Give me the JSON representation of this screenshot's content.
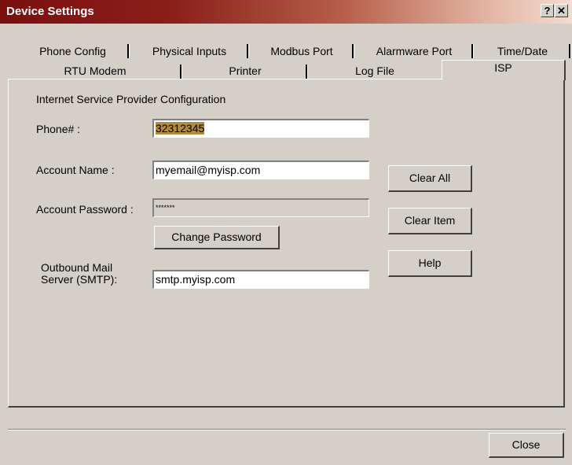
{
  "window": {
    "title": "Device Settings",
    "help_glyph": "?",
    "close_glyph": "✕"
  },
  "tabs_row1": [
    "Phone Config",
    "Physical Inputs",
    "Modbus Port",
    "Alarmware Port",
    "Time/Date"
  ],
  "tabs_row2": [
    "RTU Modem",
    "Printer",
    "Log File",
    "ISP"
  ],
  "active_tab": "ISP",
  "panel": {
    "heading": "Internet Service Provider Configuration",
    "phone_label": "Phone# :",
    "phone_value": "32312345",
    "account_name_label": "Account Name :",
    "account_name_value": "myemail@myisp.com",
    "account_password_label": "Account Password :",
    "account_password_value": "*******",
    "change_password_label": "Change Password",
    "smtp_label_line1": "Outbound Mail",
    "smtp_label_line2": "Server (SMTP):",
    "smtp_value": "smtp.myisp.com",
    "clear_all_label": "Clear All",
    "clear_item_label": "Clear Item",
    "help_label": "Help"
  },
  "footer": {
    "close_label": "Close"
  }
}
